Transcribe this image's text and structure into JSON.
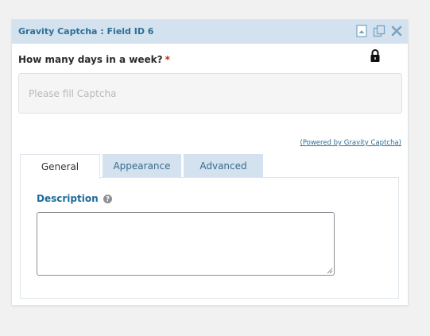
{
  "field": {
    "title": "Gravity Captcha : Field ID 6",
    "question": "How many days in a week?",
    "required_mark": "*",
    "input_placeholder": "Please fill Captcha",
    "input_value": "",
    "powered_by": "(Powered by Gravity Captcha)"
  },
  "header_icons": [
    "collapse-icon",
    "duplicate-icon",
    "close-icon"
  ],
  "tabs": [
    {
      "label": "General",
      "active": true
    },
    {
      "label": "Appearance",
      "active": false
    },
    {
      "label": "Advanced",
      "active": false
    }
  ],
  "general": {
    "description_label": "Description",
    "description_value": ""
  },
  "colors": {
    "header_bg": "#d3e2ee",
    "accent": "#2f6f95",
    "required": "#c02b0a"
  }
}
